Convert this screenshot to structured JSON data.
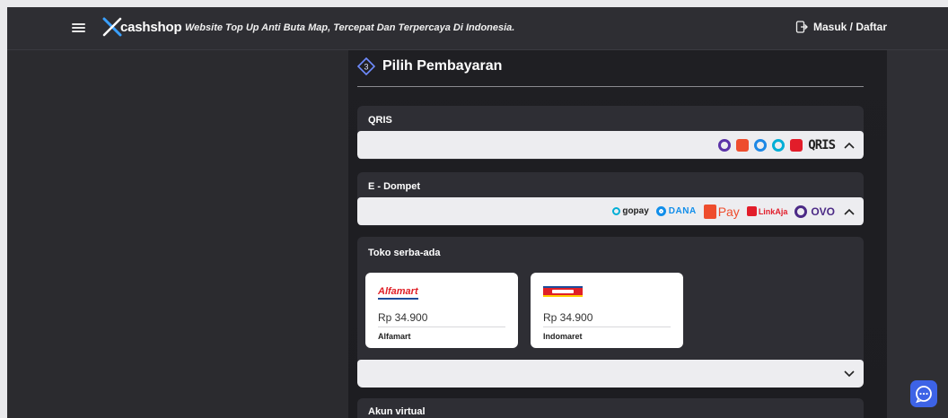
{
  "header": {
    "brand": "cashshop",
    "tagline": "Website Top Up Anti Buta Map, Tercepat Dan Terpercaya Di Indonesia.",
    "login_label": "Masuk / Daftar"
  },
  "payment": {
    "title": "Pilih Pembayaran",
    "step_number": "3",
    "qris": {
      "label": "QRIS",
      "logos": [
        "ovo-icon",
        "shopeepay-icon",
        "dana-icon",
        "gopay-icon",
        "linkaja-icon",
        "qris-logo"
      ],
      "qris_mark": "QRIS"
    },
    "ewallet": {
      "label": "E - Dompet",
      "gopay": "gopay",
      "dana": "DANA",
      "shopeepay": "Pay",
      "linkaja": "LinkAja",
      "ovo": "OVO"
    },
    "retail": {
      "label": "Toko serba-ada",
      "alfa_logo_text": "Alfamart",
      "cards": [
        {
          "name": "Alfamart",
          "price": "Rp 34.900"
        },
        {
          "name": "Indomaret",
          "price": "Rp 34.900"
        }
      ]
    },
    "virtual": {
      "label": "Akun virtual"
    }
  },
  "colors": {
    "accent": "#3d63e6",
    "panel": "#2e2e34",
    "main_bg": "#1f1f23"
  }
}
